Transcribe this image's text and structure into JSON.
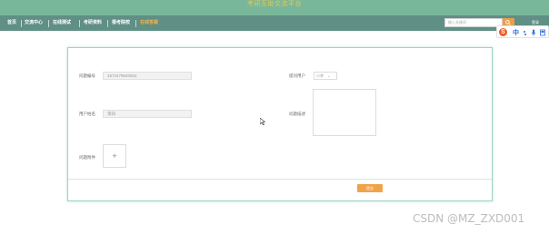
{
  "header": {
    "title": "考研互助交流平台"
  },
  "nav": {
    "items": [
      {
        "label": "首页",
        "active": false
      },
      {
        "label": "交流中心",
        "active": false
      },
      {
        "label": "在线测试",
        "active": false
      },
      {
        "label": "考研资料",
        "active": false
      },
      {
        "label": "报考院校",
        "active": false
      },
      {
        "label": "在线答疑",
        "active": true
      }
    ],
    "search_placeholder": "输入关键词",
    "login_label": "登录"
  },
  "ime": {
    "logo": "S",
    "mode": "中"
  },
  "form": {
    "question_id": {
      "label": "问题编号",
      "value": "1672479640552"
    },
    "answer_user": {
      "label": "提问用户",
      "value": "小李"
    },
    "user_name": {
      "label": "用户姓名",
      "value": "李四"
    },
    "description": {
      "label": "问题描述",
      "value": ""
    },
    "attachment": {
      "label": "问题附件",
      "button": "+"
    },
    "submit_label": "提交"
  },
  "watermark": "CSDN @MZ_ZXD001",
  "colors": {
    "header_bg": "#79b79a",
    "nav_bg": "#5f8f85",
    "accent": "#efa44a",
    "card_border": "#9fd4c5"
  }
}
